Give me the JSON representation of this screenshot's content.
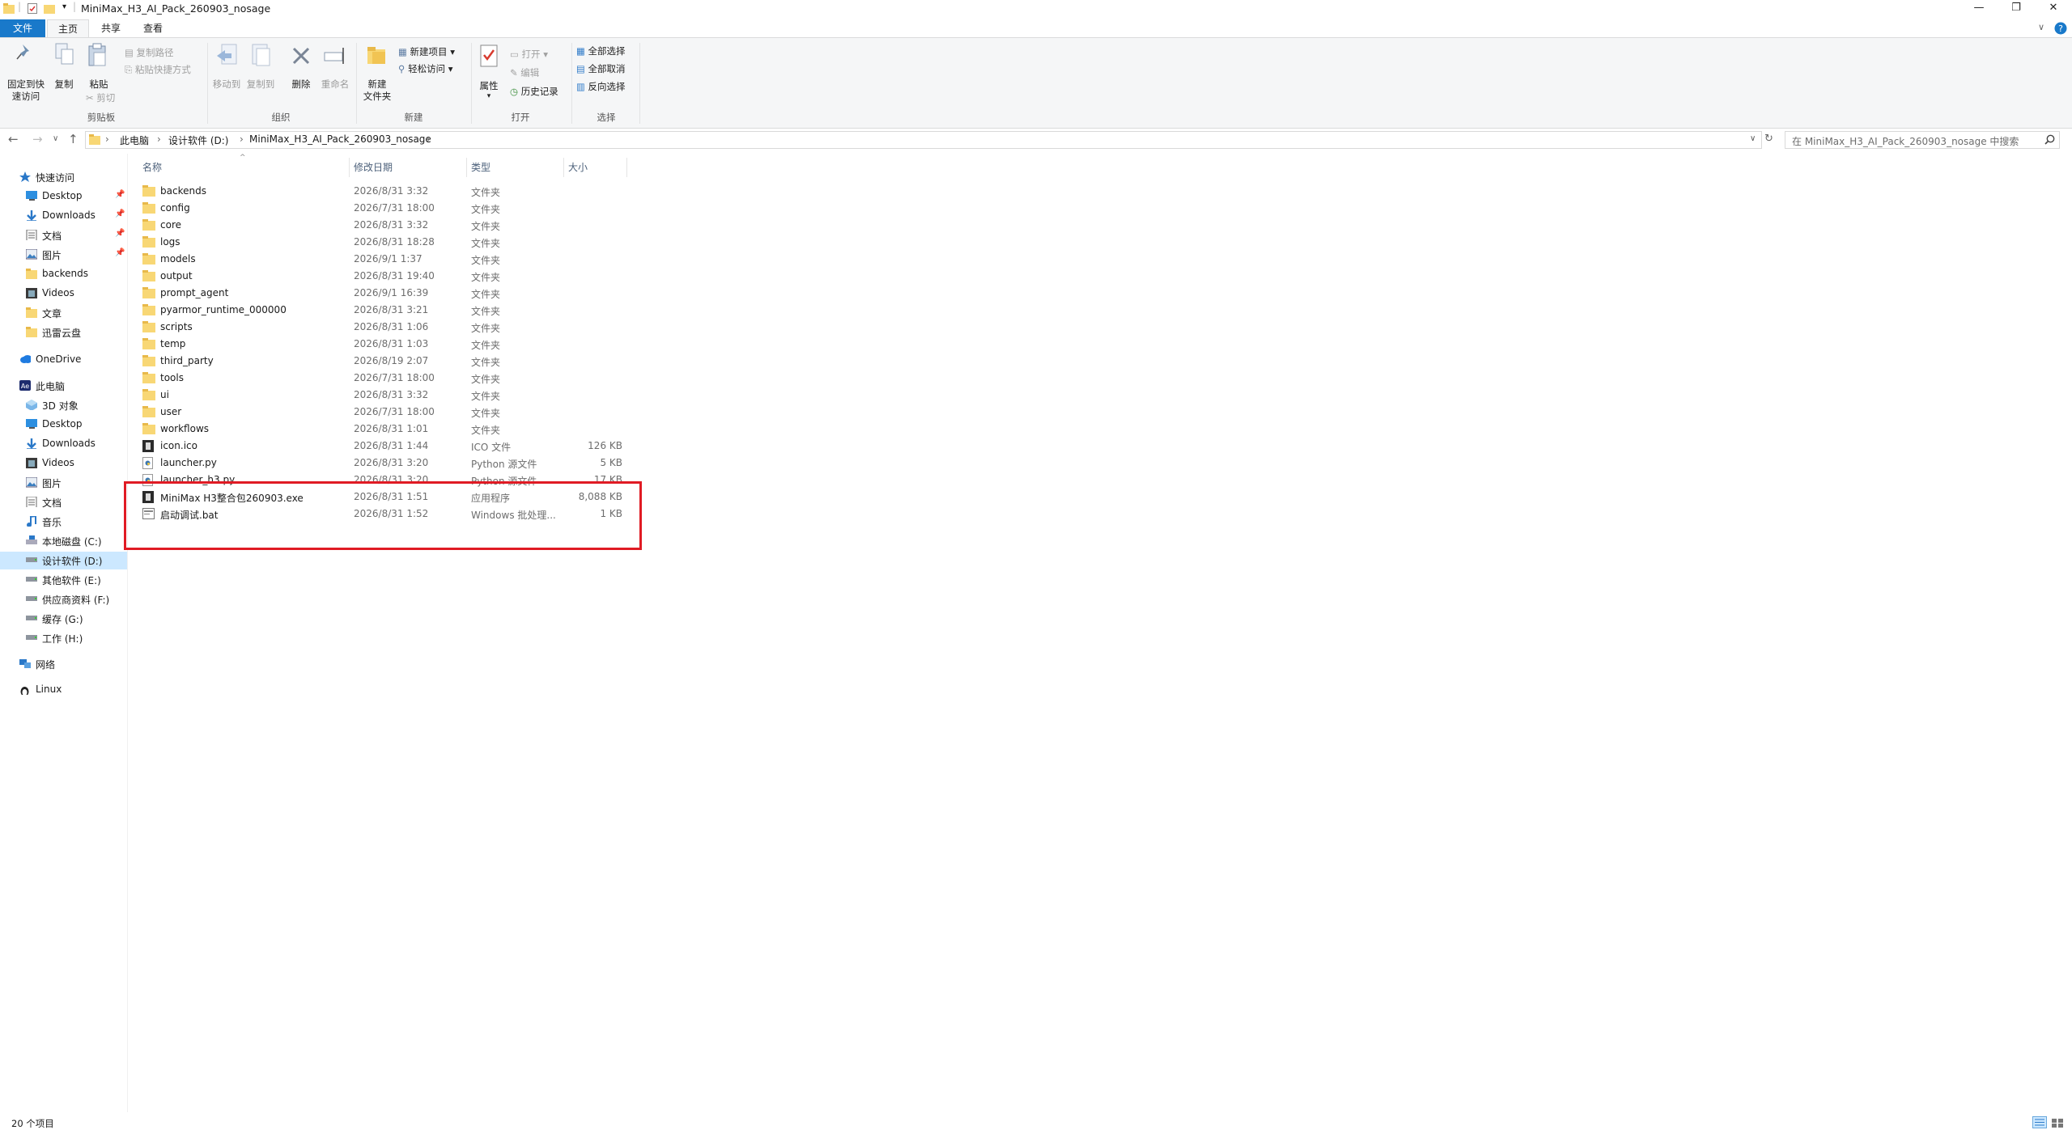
{
  "window": {
    "title": "MiniMax_H3_AI_Pack_260903_nosage",
    "controls": {
      "minimize": "—",
      "restore": "❐",
      "close": "✕"
    },
    "accent": "#1979ca"
  },
  "ribbon_tabs": [
    "文件",
    "主页",
    "共享",
    "查看"
  ],
  "ribbon": {
    "clipboard": {
      "pin_label_1": "固定到快",
      "pin_label_2": "速访问",
      "copy": "复制",
      "paste": "粘贴",
      "copy_path": "复制路径",
      "paste_shortcut": "粘贴快捷方式",
      "cut": "剪切",
      "group": "剪贴板"
    },
    "organize": {
      "move_to": "移动到",
      "copy_to": "复制到",
      "delete": "删除",
      "rename": "重命名",
      "group": "组织"
    },
    "new": {
      "new_folder_1": "新建",
      "new_folder_2": "文件夹",
      "new_item": "新建项目",
      "easy_access": "轻松访问",
      "group": "新建"
    },
    "open": {
      "properties": "属性",
      "open": "打开",
      "edit": "编辑",
      "history": "历史记录",
      "group": "打开"
    },
    "select": {
      "select_all": "全部选择",
      "select_none": "全部取消",
      "invert": "反向选择",
      "group": "选择"
    }
  },
  "address": {
    "crumbs": [
      "此电脑",
      "设计软件 (D:)",
      "MiniMax_H3_AI_Pack_260903_nosage"
    ],
    "search_placeholder": "在 MiniMax_H3_AI_Pack_260903_nosage 中搜索"
  },
  "nav": {
    "quick_access": "快速访问",
    "quick_items": [
      "Desktop",
      "Downloads",
      "文档",
      "图片",
      "backends",
      "Videos",
      "文章",
      "迅雷云盘"
    ],
    "onedrive": "OneDrive",
    "this_pc": "此电脑",
    "pc_items": [
      "3D 对象",
      "Desktop",
      "Downloads",
      "Videos",
      "图片",
      "文档",
      "音乐",
      "本地磁盘 (C:)",
      "设计软件 (D:)",
      "其他软件 (E:)",
      "供应商资料 (F:)",
      "缓存 (G:)",
      "工作 (H:)"
    ],
    "network": "网络",
    "linux": "Linux"
  },
  "columns": [
    "名称",
    "修改日期",
    "类型",
    "大小"
  ],
  "files": [
    {
      "name": "backends",
      "date": "2026/8/31 3:32",
      "type": "文件夹",
      "size": "",
      "icon": "folder-icon"
    },
    {
      "name": "config",
      "date": "2026/7/31 18:00",
      "type": "文件夹",
      "size": "",
      "icon": "folder-icon"
    },
    {
      "name": "core",
      "date": "2026/8/31 3:32",
      "type": "文件夹",
      "size": "",
      "icon": "folder-icon"
    },
    {
      "name": "logs",
      "date": "2026/8/31 18:28",
      "type": "文件夹",
      "size": "",
      "icon": "folder-icon"
    },
    {
      "name": "models",
      "date": "2026/9/1 1:37",
      "type": "文件夹",
      "size": "",
      "icon": "folder-icon"
    },
    {
      "name": "output",
      "date": "2026/8/31 19:40",
      "type": "文件夹",
      "size": "",
      "icon": "folder-icon"
    },
    {
      "name": "prompt_agent",
      "date": "2026/9/1 16:39",
      "type": "文件夹",
      "size": "",
      "icon": "folder-icon"
    },
    {
      "name": "pyarmor_runtime_000000",
      "date": "2026/8/31 3:21",
      "type": "文件夹",
      "size": "",
      "icon": "folder-icon"
    },
    {
      "name": "scripts",
      "date": "2026/8/31 1:06",
      "type": "文件夹",
      "size": "",
      "icon": "folder-icon"
    },
    {
      "name": "temp",
      "date": "2026/8/31 1:03",
      "type": "文件夹",
      "size": "",
      "icon": "folder-icon"
    },
    {
      "name": "third_party",
      "date": "2026/8/19 2:07",
      "type": "文件夹",
      "size": "",
      "icon": "folder-icon"
    },
    {
      "name": "tools",
      "date": "2026/7/31 18:00",
      "type": "文件夹",
      "size": "",
      "icon": "folder-icon"
    },
    {
      "name": "ui",
      "date": "2026/8/31 3:32",
      "type": "文件夹",
      "size": "",
      "icon": "folder-icon"
    },
    {
      "name": "user",
      "date": "2026/7/31 18:00",
      "type": "文件夹",
      "size": "",
      "icon": "folder-icon"
    },
    {
      "name": "workflows",
      "date": "2026/8/31 1:01",
      "type": "文件夹",
      "size": "",
      "icon": "folder-icon"
    },
    {
      "name": "icon.ico",
      "date": "2026/8/31 1:44",
      "type": "ICO 文件",
      "size": "126 KB",
      "icon": "ico-file-icon"
    },
    {
      "name": "launcher.py",
      "date": "2026/8/31 3:20",
      "type": "Python 源文件",
      "size": "5 KB",
      "icon": "python-file-icon"
    },
    {
      "name": "launcher_h3.py",
      "date": "2026/8/31 3:20",
      "type": "Python 源文件",
      "size": "17 KB",
      "icon": "python-file-icon"
    },
    {
      "name": "MiniMax H3整合包260903.exe",
      "date": "2026/8/31 1:51",
      "type": "应用程序",
      "size": "8,088 KB",
      "icon": "exe-file-icon"
    },
    {
      "name": "启动调试.bat",
      "date": "2026/8/31 1:52",
      "type": "Windows 批处理...",
      "size": "1 KB",
      "icon": "bat-file-icon"
    }
  ],
  "status": {
    "count": "20 个项目"
  },
  "highlight_color": "#e01b24"
}
